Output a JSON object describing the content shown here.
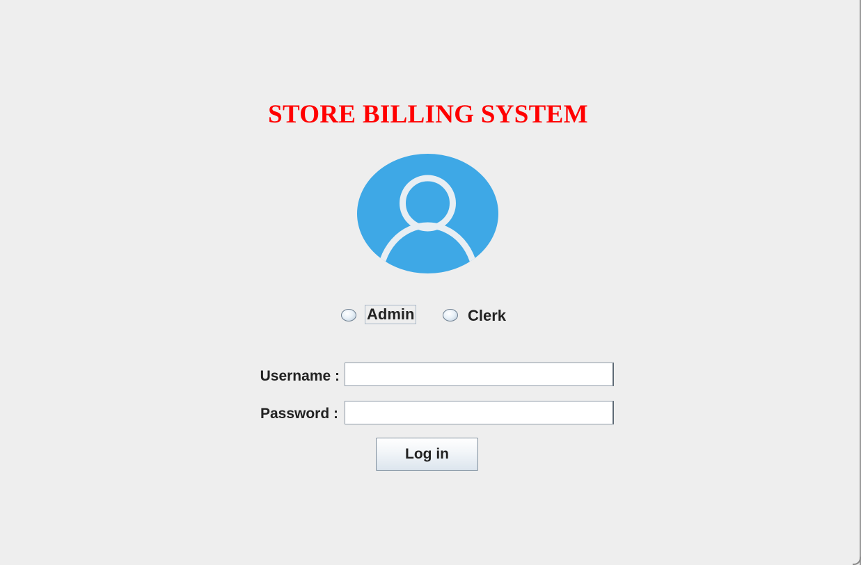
{
  "app": {
    "title": "STORE BILLING SYSTEM"
  },
  "avatar": {
    "icon": "user-profile-icon",
    "color": "#3ea8e6"
  },
  "role": {
    "options": [
      {
        "label": "Admin",
        "selected": false
      },
      {
        "label": "Clerk",
        "selected": false
      }
    ]
  },
  "form": {
    "username_label": "Username :",
    "username_value": "",
    "password_label": "Password :",
    "password_value": ""
  },
  "actions": {
    "login_label": "Log in"
  },
  "colors": {
    "title": "#ff0000",
    "background": "#eeeeee",
    "avatar": "#3ea8e6"
  }
}
